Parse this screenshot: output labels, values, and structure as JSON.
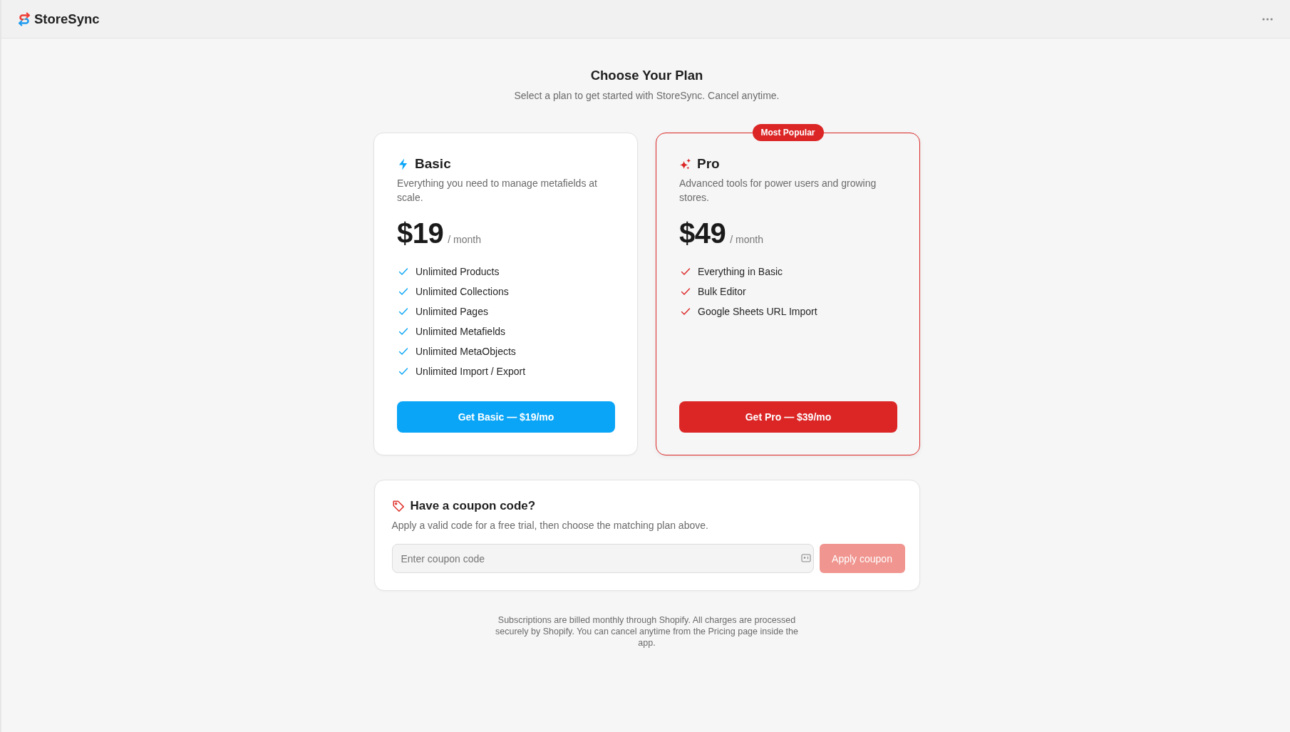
{
  "header": {
    "app_name": "StoreSync"
  },
  "intro": {
    "title": "Choose Your Plan",
    "subtitle": "Select a plan to get started with StoreSync. Cancel anytime."
  },
  "plans": [
    {
      "name": "Basic",
      "featured": false,
      "color": "#0aa5f7",
      "description": "Everything you need to manage metafields at scale.",
      "price": "$19",
      "period": "/ month",
      "features": [
        "Unlimited Products",
        "Unlimited Collections",
        "Unlimited Pages",
        "Unlimited Metafields",
        "Unlimited MetaObjects",
        "Unlimited Import / Export"
      ],
      "button": "Get Basic — $19/mo"
    },
    {
      "name": "Pro",
      "featured": true,
      "badge": "Most Popular",
      "color": "#dc2626",
      "description": "Advanced tools for power users and growing stores.",
      "price": "$49",
      "period": "/ month",
      "features": [
        "Everything in Basic",
        "Bulk Editor",
        "Google Sheets URL Import"
      ],
      "button": "Get Pro — $39/mo"
    }
  ],
  "coupon": {
    "title": "Have a coupon code?",
    "description": "Apply a valid code for a free trial, then choose the matching plan above.",
    "input": {
      "placeholder": "Enter coupon code"
    },
    "button": {
      "label": "Apply coupon",
      "disabled": true
    }
  },
  "footer_note": "Subscriptions are billed monthly through Shopify. All charges are processed securely by Shopify. You can cancel anytime from the Pricing page inside the app."
}
